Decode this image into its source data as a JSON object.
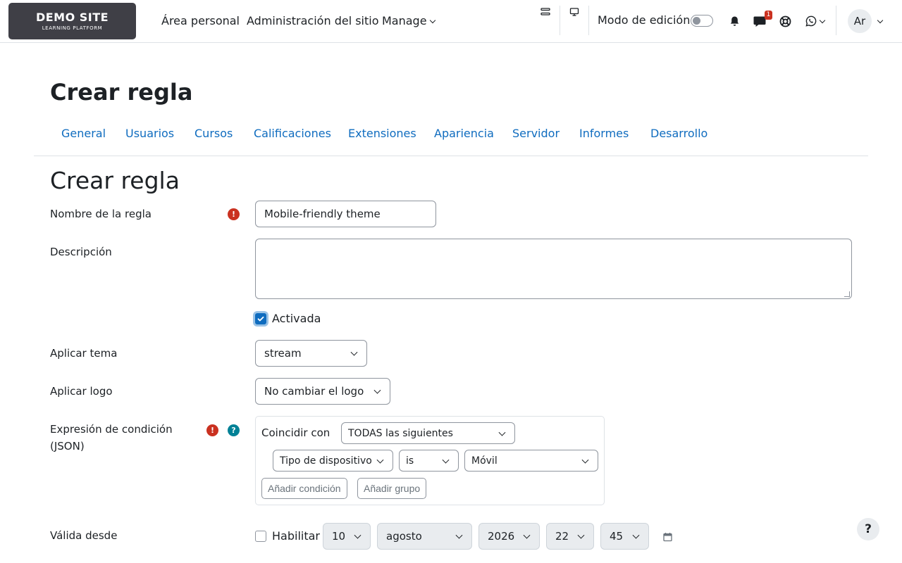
{
  "navbar": {
    "logo_title": "DEMO SITE",
    "logo_subtitle": "LEARNING PLATFORM",
    "links": [
      "Área personal",
      "Administración del sitio",
      "Manage"
    ],
    "edit_mode_label": "Modo de edición",
    "edit_mode_on": false,
    "messages_badge": "1",
    "user_initials": "Ar"
  },
  "page": {
    "heading": "Crear regla",
    "tabs": [
      "General",
      "Usuarios",
      "Cursos",
      "Calificaciones",
      "Extensiones",
      "Apariencia",
      "Servidor",
      "Informes",
      "Desarrollo"
    ]
  },
  "form": {
    "heading": "Crear regla",
    "rule_name_label": "Nombre de la regla",
    "rule_name_value": "Mobile-friendly theme",
    "description_label": "Descripción",
    "description_value": "",
    "enabled_label": "Activada",
    "enabled": true,
    "theme_label": "Aplicar tema",
    "theme_value": "stream",
    "logo_label": "Aplicar logo",
    "logo_value": "No cambiar el logo",
    "condition_label_line1": "Expresión de condición",
    "condition_label_line2": "(JSON)",
    "condition": {
      "match_label": "Coincidir con",
      "match_value": "TODAS las siguientes",
      "field_value": "Tipo de dispositivo",
      "operator_value": "is",
      "value_value": "Móvil",
      "add_condition_label": "Añadir condición",
      "add_group_label": "Añadir grupo"
    },
    "valid_from_label": "Válida desde",
    "valid_from_enable_label": "Habilitar",
    "valid_from_enabled": false,
    "valid_from": {
      "day": "10",
      "month": "agosto",
      "year": "2026",
      "hour": "22",
      "minute": "45"
    }
  },
  "help_button": "?",
  "colors": {
    "link": "#0f6cbf",
    "required": "#ca3120",
    "help": "#008196",
    "logo_bg": "#3f3f46"
  }
}
